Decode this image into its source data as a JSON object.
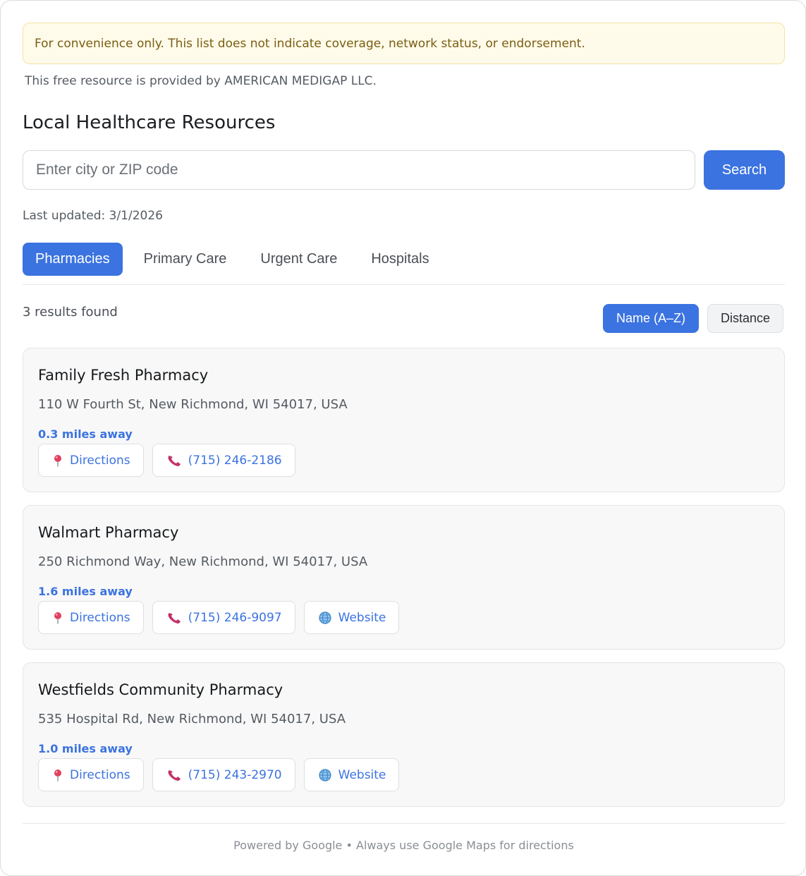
{
  "notice": "For convenience only. This list does not indicate coverage, network status, or endorsement.",
  "provider": "This free resource is provided by AMERICAN MEDIGAP LLC.",
  "title": "Local Healthcare Resources",
  "search": {
    "placeholder": "Enter city or ZIP code",
    "value": "",
    "button_label": "Search"
  },
  "last_updated": "Last updated: 3/1/2026",
  "tabs": [
    {
      "label": "Pharmacies",
      "active": true
    },
    {
      "label": "Primary Care",
      "active": false
    },
    {
      "label": "Urgent Care",
      "active": false
    },
    {
      "label": "Hospitals",
      "active": false
    }
  ],
  "results_count": "3 results found",
  "sort": [
    {
      "label": "Name (A–Z)",
      "active": true
    },
    {
      "label": "Distance",
      "active": false
    }
  ],
  "results": [
    {
      "name": "Family Fresh Pharmacy",
      "address": "110 W Fourth St, New Richmond, WI 54017, USA",
      "distance": "0.3 miles away",
      "directions_label": "Directions",
      "phone": "(715) 246-2186",
      "website_label": ""
    },
    {
      "name": "Walmart Pharmacy",
      "address": "250 Richmond Way, New Richmond, WI 54017, USA",
      "distance": "1.6 miles away",
      "directions_label": "Directions",
      "phone": "(715) 246-9097",
      "website_label": "Website"
    },
    {
      "name": "Westfields Community Pharmacy",
      "address": "535 Hospital Rd, New Richmond, WI 54017, USA",
      "distance": "1.0 miles away",
      "directions_label": "Directions",
      "phone": "(715) 243-2970",
      "website_label": "Website"
    }
  ],
  "icons": {
    "directions": "map-pin-icon",
    "phone": "phone-icon",
    "website": "globe-icon"
  },
  "colors": {
    "accent": "#3b73e0",
    "notice_bg": "#fffbea",
    "notice_text": "#7a5d12",
    "pin": "#e0405e",
    "phone": "#c2336a"
  },
  "footer": "Powered by Google • Always use Google Maps for directions"
}
